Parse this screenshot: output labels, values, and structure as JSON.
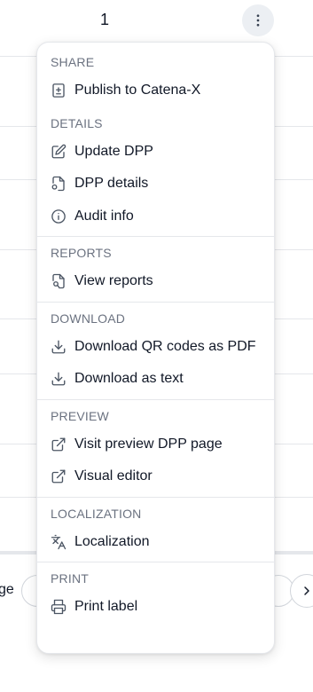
{
  "table": {
    "visible_value": "1"
  },
  "pager": {
    "label_fragment": "ge"
  },
  "menu": {
    "sections": [
      {
        "title": "SHARE",
        "items": [
          {
            "label": "Publish to Catena-X",
            "icon": "file-plus-icon"
          }
        ]
      },
      {
        "title": "DETAILS",
        "items": [
          {
            "label": "Update DPP",
            "icon": "edit-icon"
          },
          {
            "label": "DPP details",
            "icon": "file-cog-icon"
          },
          {
            "label": "Audit info",
            "icon": "info-icon"
          }
        ]
      },
      {
        "title": "REPORTS",
        "items": [
          {
            "label": "View reports",
            "icon": "file-search-icon"
          }
        ]
      },
      {
        "title": "DOWNLOAD",
        "items": [
          {
            "label": "Download QR codes as PDF",
            "icon": "download-icon"
          },
          {
            "label": "Download as text",
            "icon": "download-icon"
          }
        ]
      },
      {
        "title": "PREVIEW",
        "items": [
          {
            "label": "Visit preview DPP page",
            "icon": "external-link-icon"
          },
          {
            "label": "Visual editor",
            "icon": "external-link-icon"
          }
        ]
      },
      {
        "title": "LOCALIZATION",
        "items": [
          {
            "label": "Localization",
            "icon": "languages-icon"
          }
        ]
      },
      {
        "title": "PRINT",
        "items": [
          {
            "label": "Print label",
            "icon": "printer-icon"
          }
        ]
      }
    ]
  }
}
